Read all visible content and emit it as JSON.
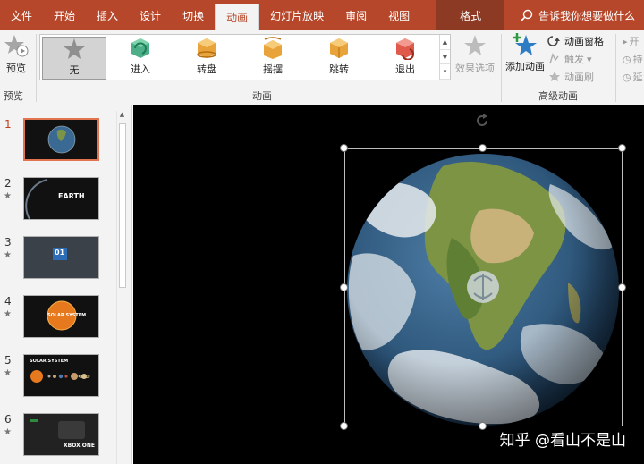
{
  "tabs": {
    "file": "文件",
    "home": "开始",
    "insert": "插入",
    "design": "设计",
    "transitions": "切换",
    "animations": "动画",
    "slideshow": "幻灯片放映",
    "review": "审阅",
    "view": "视图",
    "format": "格式"
  },
  "tell_me": {
    "placeholder": "告诉我你想要做什么"
  },
  "ribbon": {
    "preview": {
      "button": "预览",
      "group": "预览"
    },
    "animation_group": "动画",
    "gallery": [
      {
        "label": "无",
        "icon": "star-icon",
        "color": "#9a9a9a",
        "selected": true
      },
      {
        "label": "进入",
        "icon": "box-enter-icon",
        "color": "#4caf87"
      },
      {
        "label": "转盘",
        "icon": "box-spin-icon",
        "color": "#e8a33a"
      },
      {
        "label": "摇摆",
        "icon": "box-swing-icon",
        "color": "#e8a33a"
      },
      {
        "label": "跳转",
        "icon": "box-jump-icon",
        "color": "#e8a33a"
      },
      {
        "label": "退出",
        "icon": "box-exit-icon",
        "color": "#e05a4b"
      }
    ],
    "effect_options": "效果选项",
    "advanced": {
      "add_animation": "添加动画",
      "animation_pane": "动画窗格",
      "trigger": "触发",
      "painter": "动画刷",
      "group": "高级动画"
    },
    "timing": {
      "start": "开",
      "duration": "持",
      "delay": "延"
    }
  },
  "slides": [
    {
      "number": "1",
      "selected": true,
      "star": false,
      "caption": ""
    },
    {
      "number": "2",
      "selected": false,
      "star": true,
      "caption": "EARTH"
    },
    {
      "number": "3",
      "selected": false,
      "star": true,
      "caption": "01"
    },
    {
      "number": "4",
      "selected": false,
      "star": true,
      "caption": "SOLAR SYSTEM"
    },
    {
      "number": "5",
      "selected": false,
      "star": true,
      "caption": "SOLAR SYSTEM"
    },
    {
      "number": "6",
      "selected": false,
      "star": true,
      "caption": "XBOX ONE"
    }
  ],
  "slide_star": "★",
  "watermark": "知乎 @看山不是山",
  "colors": {
    "accent": "#b7472a",
    "selected_thumb_border": "#e2734f",
    "ocean": "#2f5f8a",
    "land": "#6b8f3a"
  }
}
